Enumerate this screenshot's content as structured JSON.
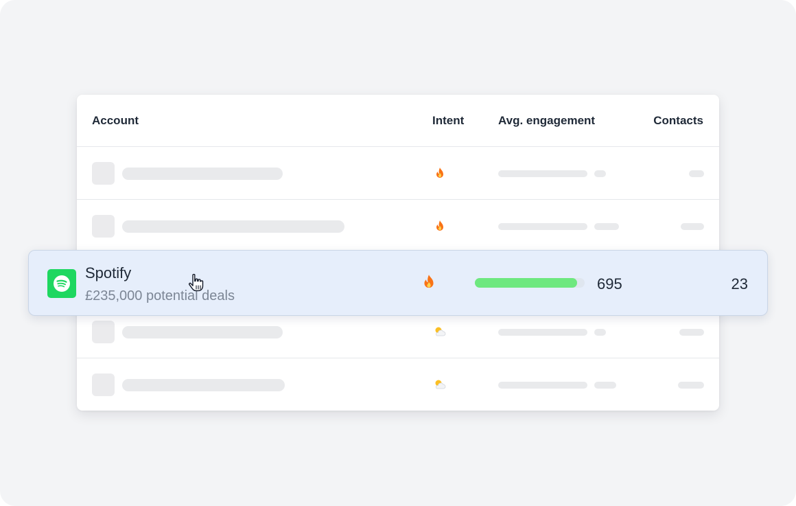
{
  "table": {
    "headers": {
      "account": "Account",
      "intent": "Intent",
      "engagement": "Avg. engagement",
      "contacts": "Contacts"
    },
    "placeholder_rows": [
      {
        "intent_icon": "fire-icon"
      },
      {
        "intent_icon": "fire-icon"
      },
      {
        "intent_icon": "sun-behind-cloud-icon"
      },
      {
        "intent_icon": "sun-behind-cloud-icon"
      }
    ]
  },
  "highlighted_row": {
    "logo_icon": "spotify-logo-icon",
    "account_name": "Spotify",
    "potential_deals": "£235,000 potential deals",
    "intent_icon": "fire-icon",
    "engagement_value": "695",
    "engagement_fraction": 0.93,
    "contacts": "23",
    "cursor_icon": "hand-pointer-icon"
  },
  "colors": {
    "highlight_bg": "#e6eefb",
    "spotify_green": "#1ed760",
    "engagement_bar": "#6ee87f",
    "fire": "#f97316"
  }
}
